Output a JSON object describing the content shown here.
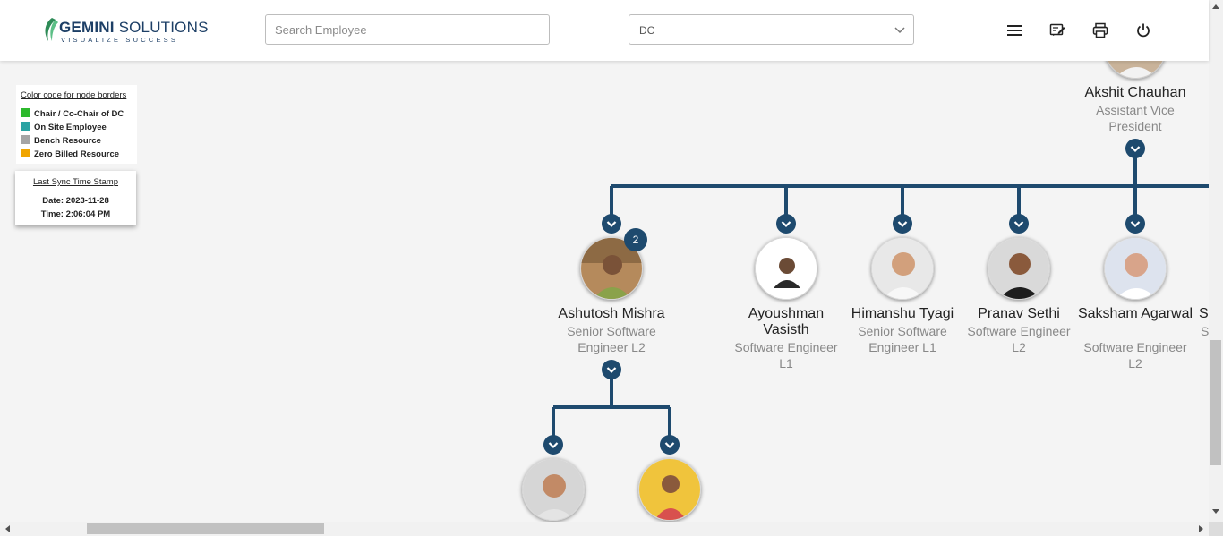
{
  "header": {
    "logo_main_bold": "GEMINI",
    "logo_main_rest": " SOLUTIONS",
    "logo_tagline": "VISUALIZE SUCCESS",
    "search_placeholder": "Search Employee",
    "department_selected": "DC",
    "icons": [
      "menu-icon",
      "feedback-icon",
      "printer-icon",
      "power-icon"
    ]
  },
  "legend": {
    "title": "Color code for node borders",
    "items": [
      {
        "label": "Chair / Co-Chair of DC",
        "color": "#2db92d"
      },
      {
        "label": "On Site Employee",
        "color": "#2aa3a3"
      },
      {
        "label": "Bench Resource",
        "color": "#a5a5a5"
      },
      {
        "label": "Zero Billed Resource",
        "color": "#f0a500"
      }
    ]
  },
  "sync": {
    "title": "Last Sync Time Stamp",
    "date": "Date: 2023-11-28",
    "time": "Time: 2:06:04 PM"
  },
  "org": {
    "root": {
      "name": "Akshit Chauhan",
      "role": "Assistant Vice President"
    },
    "children": [
      {
        "name": "Ashutosh Mishra",
        "role": "Senior Software Engineer L2",
        "reports_count": "2"
      },
      {
        "name": "Ayoushman Vasisth",
        "role": "Software Engineer L1"
      },
      {
        "name": "Himanshu Tyagi",
        "role": "Senior Software Engineer L1"
      },
      {
        "name": "Pranav Sethi",
        "role": "Software Engineer L2"
      },
      {
        "name": "Saksham Agarwal",
        "role": "Software Engineer L2"
      },
      {
        "name": "S",
        "role": "S"
      }
    ]
  },
  "colors": {
    "connector": "#1e4a6e",
    "accent": "#1d3f66"
  }
}
